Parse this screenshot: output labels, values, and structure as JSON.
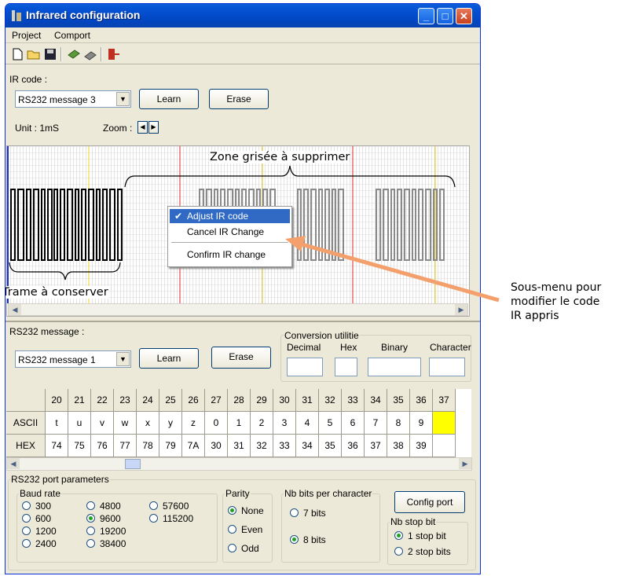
{
  "window": {
    "title": "Infrared configuration",
    "minimize": "_",
    "maximize": "□",
    "close": "✕"
  },
  "menu": {
    "project": "Project",
    "comport": "Comport"
  },
  "toolbar": {
    "icons": [
      "new-file-icon",
      "open-folder-icon",
      "save-disk-icon",
      "download-icon",
      "upload-icon",
      "exit-door-icon"
    ]
  },
  "ir": {
    "label": "IR code :",
    "combo_value": "RS232 message 3",
    "learn": "Learn",
    "erase": "Erase",
    "unit": "Unit : 1mS",
    "zoom": "Zoom :",
    "zone_label": "Zone grisée à supprimer",
    "keep_label": "Trame à conserver"
  },
  "context_menu": {
    "adjust": "Adjust IR code",
    "cancel": "Cancel IR Change",
    "confirm": "Confirm IR change",
    "check": "✔"
  },
  "annotation": {
    "line1": "Sous-menu pour",
    "line2": "modifier le code",
    "line3": "IR appris"
  },
  "rs232": {
    "label": "RS232 message :",
    "combo_value": "RS232 message 1",
    "learn": "Learn",
    "erase": "Erase"
  },
  "conversion": {
    "title": "Conversion utilitie",
    "decimal": "Decimal",
    "hex": "Hex",
    "binary": "Binary",
    "character": "Character"
  },
  "table": {
    "columns": [
      "20",
      "21",
      "22",
      "23",
      "24",
      "25",
      "26",
      "27",
      "28",
      "29",
      "30",
      "31",
      "32",
      "33",
      "34",
      "35",
      "36",
      "37"
    ],
    "ascii_label": "ASCII",
    "hex_label": "HEX",
    "ascii": [
      "t",
      "u",
      "v",
      "w",
      "x",
      "y",
      "z",
      "0",
      "1",
      "2",
      "3",
      "4",
      "5",
      "6",
      "7",
      "8",
      "9",
      ""
    ],
    "hex": [
      "74",
      "75",
      "76",
      "77",
      "78",
      "79",
      "7A",
      "30",
      "31",
      "32",
      "33",
      "34",
      "35",
      "36",
      "37",
      "38",
      "39",
      ""
    ],
    "highlight_color": "#ffff00"
  },
  "port": {
    "title": "RS232 port parameters",
    "baud_title": "Baud rate",
    "baud": [
      "300",
      "600",
      "1200",
      "2400",
      "4800",
      "9600",
      "19200",
      "38400",
      "57600",
      "115200"
    ],
    "baud_selected": "9600",
    "parity_title": "Parity",
    "parity": [
      "None",
      "Even",
      "Odd"
    ],
    "parity_selected": "None",
    "nbbits_title": "Nb bits per character",
    "nbbits": [
      "7 bits",
      "8 bits"
    ],
    "nbbits_selected": "8 bits",
    "config": "Config port",
    "stop_title": "Nb stop bit",
    "stop": [
      "1 stop bit",
      "2 stop bits"
    ],
    "stop_selected": "1 stop bit"
  },
  "colors": {
    "titlebar": "#0553d4",
    "selection": "#316ac5",
    "arrow": "#f4a06c"
  }
}
